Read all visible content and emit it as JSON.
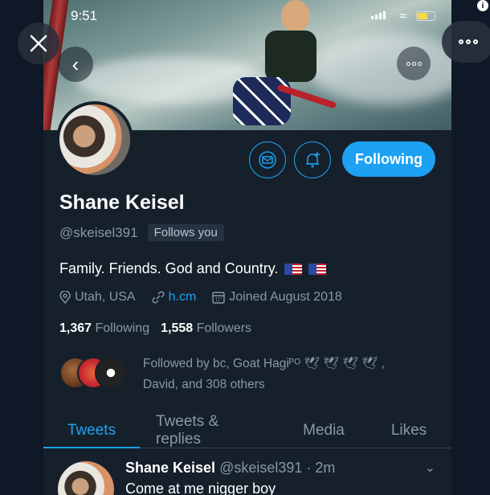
{
  "status_bar": {
    "time": "9:51"
  },
  "profile": {
    "name": "Shane Keisel",
    "handle": "@skeisel391",
    "follows_you": "Follows you",
    "bio": "Family. Friends. God and Country.",
    "location": "Utah, USA",
    "website": "h.cm",
    "joined": "Joined August 2018",
    "following_count": "1,367",
    "following_label": "Following",
    "followers_count": "1,558",
    "followers_label": "Followers",
    "followed_by_line1": "Followed by bc, Goat Hagiᴾᴼ 🕊︎ 🕊︎ 🕊︎ 🕊︎ ,",
    "followed_by_line2": "David, and 308 others"
  },
  "buttons": {
    "follow_state": "Following"
  },
  "tabs": [
    {
      "label": "Tweets",
      "active": true
    },
    {
      "label": "Tweets & replies",
      "active": false
    },
    {
      "label": "Media",
      "active": false
    },
    {
      "label": "Likes",
      "active": false
    }
  ],
  "tweet": {
    "author": "Shane Keisel",
    "handle_time": "@skeisel391 · 2m",
    "text": "Come at me nigger boy"
  },
  "colors": {
    "accent": "#1da1f2",
    "background": "#15202b",
    "muted": "#8899a6"
  },
  "icons": [
    "close-icon",
    "more-icon",
    "info-icon",
    "back-icon",
    "mail-icon",
    "bell-plus-icon",
    "location-icon",
    "link-icon",
    "calendar-icon",
    "chevron-down-icon"
  ]
}
